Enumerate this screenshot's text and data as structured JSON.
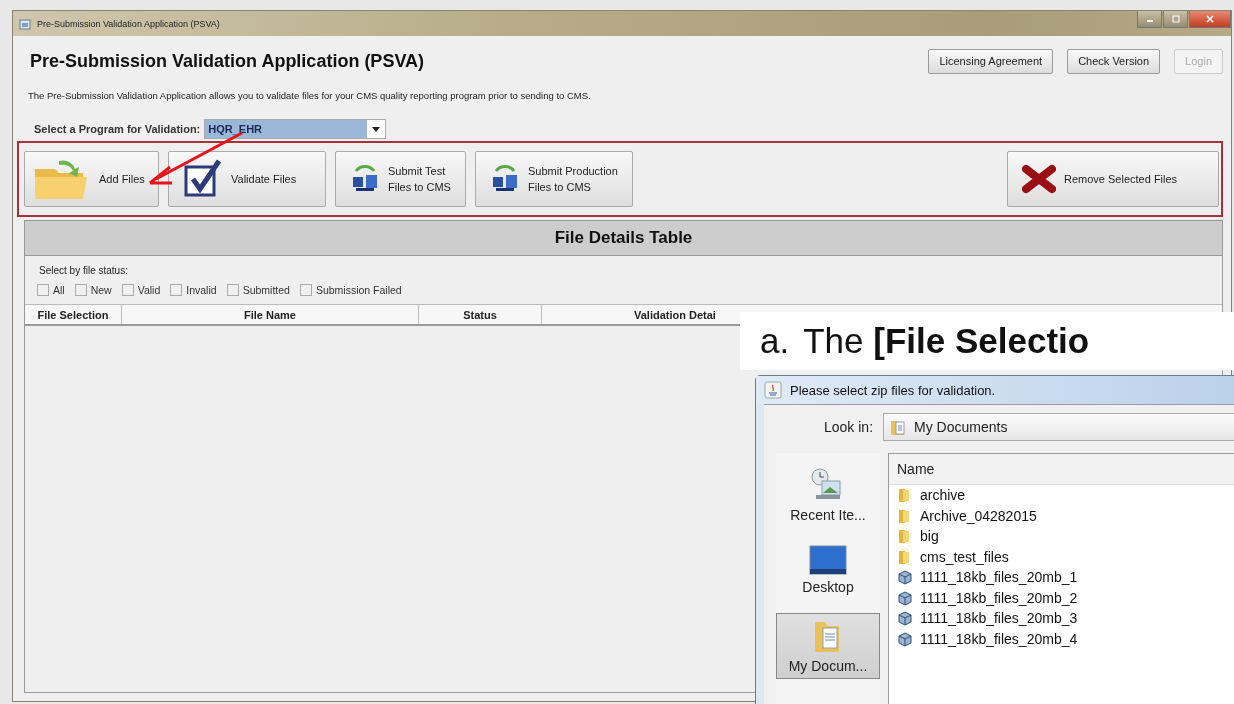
{
  "window": {
    "title": "Pre-Submission Validation Application (PSVA)"
  },
  "header": {
    "title": "Pre-Submission Validation Application (PSVA)",
    "buttons": [
      {
        "label": "Licensing Agreement",
        "disabled": false
      },
      {
        "label": "Check Version",
        "disabled": false
      },
      {
        "label": "Login",
        "disabled": true
      }
    ]
  },
  "description": "The Pre-Submission Validation Application allows you to validate files for your CMS quality reporting program prior to sending to CMS.",
  "program_select": {
    "label": "Select a Program for Validation:",
    "value": "HQR_EHR"
  },
  "toolbar": [
    {
      "kind": "add",
      "lines": [
        "Add Files"
      ]
    },
    {
      "kind": "validate",
      "lines": [
        "Validate Files"
      ]
    },
    {
      "kind": "submit",
      "lines": [
        "Submit Test",
        "Files to CMS"
      ]
    },
    {
      "kind": "submit",
      "lines": [
        "Submit Production",
        "Files to CMS"
      ]
    },
    {
      "kind": "remove",
      "lines": [
        "Remove Selected Files"
      ]
    }
  ],
  "file_table": {
    "title": "File Details Table",
    "filter_label": "Select by file status:",
    "filters": [
      {
        "label": "All",
        "checked": false
      },
      {
        "label": "New",
        "checked": false
      },
      {
        "label": "Valid",
        "checked": false
      },
      {
        "label": "Invalid",
        "checked": false
      },
      {
        "label": "Submitted",
        "checked": false
      },
      {
        "label": "Submission Failed",
        "checked": false
      }
    ],
    "columns": [
      "File Selection",
      "File Name",
      "Status",
      "Validation Detai"
    ]
  },
  "caption": {
    "prefix": "a.",
    "text": "The **[File Selectio**"
  },
  "dialog": {
    "title": "Please select zip files for validation.",
    "look_in_label": "Look in:",
    "look_in_value": "My Documents",
    "places": [
      {
        "label": "Recent Ite...",
        "kind": "recent",
        "selected": false
      },
      {
        "label": "Desktop",
        "kind": "desktop",
        "selected": false
      },
      {
        "label": "My Docum...",
        "kind": "documents",
        "selected": true
      }
    ],
    "column": "Name",
    "files": [
      {
        "name": "archive",
        "kind": "folder"
      },
      {
        "name": "Archive_04282015",
        "kind": "folder"
      },
      {
        "name": "big",
        "kind": "folder"
      },
      {
        "name": "cms_test_files",
        "kind": "folder"
      },
      {
        "name": "1111_18kb_files_20mb_1",
        "kind": "archive"
      },
      {
        "name": "1111_18kb_files_20mb_2",
        "kind": "archive"
      },
      {
        "name": "1111_18kb_files_20mb_3",
        "kind": "archive"
      },
      {
        "name": "1111_18kb_files_20mb_4",
        "kind": "archive"
      }
    ]
  }
}
